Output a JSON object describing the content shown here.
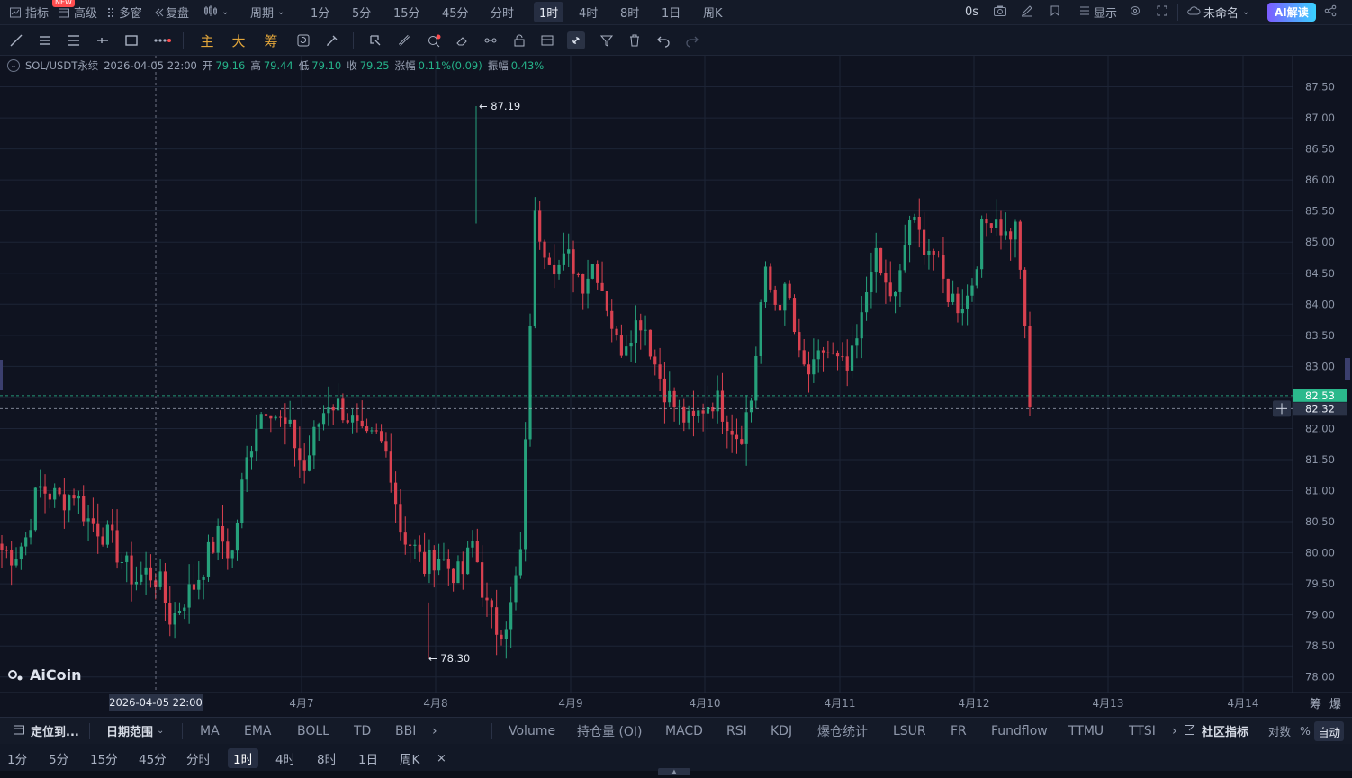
{
  "topbar": {
    "indicators": "指标",
    "new_badge": "NEW",
    "advanced": "高级",
    "multi": "多窗",
    "replay": "复盘",
    "period": "周期",
    "intervals": [
      "1分",
      "5分",
      "15分",
      "45分",
      "分时",
      "1时",
      "4时",
      "8时",
      "1日",
      "周K"
    ],
    "active_interval": "1时",
    "latency": "0s",
    "display": "显示",
    "layout_name": "未命名",
    "ai": "AI解读"
  },
  "drawtools": {
    "main": "主",
    "big": "大",
    "chip": "筹"
  },
  "ohlc": {
    "symbol": "SOL/USDT永续",
    "time": "2026-04-05 22:00",
    "open_label": "开",
    "open": "79.16",
    "high_label": "高",
    "high": "79.44",
    "low_label": "低",
    "low": "79.10",
    "close_label": "收",
    "close": "79.25",
    "change_label": "涨幅",
    "change": "0.11%(0.09)",
    "amp_label": "振幅",
    "amp": "0.43%"
  },
  "colors": {
    "up": "#26a17b",
    "down": "#d94150",
    "bg": "#0f1320",
    "grid": "#1d2436",
    "accent": "#2bb98c"
  },
  "chart_data": {
    "type": "candlestick",
    "symbol": "SOL/USDT永续",
    "interval": "1时",
    "y_ticks": [
      "87.50",
      "87.00",
      "86.50",
      "86.00",
      "85.50",
      "85.00",
      "84.50",
      "84.00",
      "83.50",
      "83.00",
      "82.50",
      "82.00",
      "81.50",
      "81.00",
      "80.50",
      "80.00",
      "79.50",
      "79.00",
      "78.50",
      "78.00"
    ],
    "ylim": [
      77.75,
      88.0
    ],
    "x_ticks": [
      "4月7",
      "4月8",
      "4月9",
      "4月10",
      "4月11",
      "4月12",
      "4月13",
      "4月14"
    ],
    "crosshair_date": "2026-04-05 22:00",
    "last_price": "82.53",
    "crosshair_price": "82.32",
    "high_marker": "87.19",
    "low_marker": "78.30",
    "watermark": "AiCoin",
    "close_path": [
      80.05,
      79.95,
      80.25,
      81.05,
      80.95,
      80.85,
      81.0,
      80.55,
      80.4,
      80.2,
      79.85,
      79.55,
      79.7,
      79.55,
      78.9,
      79.25,
      79.5,
      79.95,
      80.3,
      79.9,
      81.25,
      82.1,
      82.45,
      82.1,
      81.9,
      81.3,
      82.0,
      82.45,
      82.35,
      82.1,
      81.75,
      81.85,
      81.55,
      80.35,
      80.1,
      79.75,
      80.0,
      79.75,
      79.6,
      80.2,
      79.15,
      78.75,
      79.0,
      80.1,
      85.4,
      84.9,
      84.6,
      84.75,
      84.35,
      84.7,
      84.05,
      83.25,
      83.6,
      83.8,
      83.05,
      82.55,
      82.25,
      82.05,
      82.35,
      82.5,
      82.15,
      81.85,
      82.5,
      84.5,
      84.0,
      84.2,
      83.0,
      82.85,
      83.3,
      83.05,
      82.9,
      83.6,
      84.85,
      84.3,
      84.05,
      85.4,
      85.05,
      84.85,
      84.25,
      84.0,
      84.15,
      85.15,
      85.5,
      85.1,
      85.25,
      82.3
    ]
  },
  "indicators_bar": {
    "locate": "定位到...",
    "date_range": "日期范围",
    "overlays": [
      "MA",
      "EMA",
      "BOLL",
      "TD",
      "BBI"
    ],
    "subs": [
      "Volume",
      "持仓量 (OI)",
      "MACD",
      "RSI",
      "KDJ",
      "爆仓统计",
      "LSUR",
      "FR",
      "Fundflow",
      "TTMU",
      "TTSI"
    ],
    "community": "社区指标",
    "log": "对数",
    "percent": "%",
    "auto": "自动"
  },
  "period_bar": {
    "items": [
      "1分",
      "5分",
      "15分",
      "45分",
      "分时",
      "1时",
      "4时",
      "8时",
      "1日",
      "周K"
    ],
    "active": "1时",
    "close": "×"
  }
}
